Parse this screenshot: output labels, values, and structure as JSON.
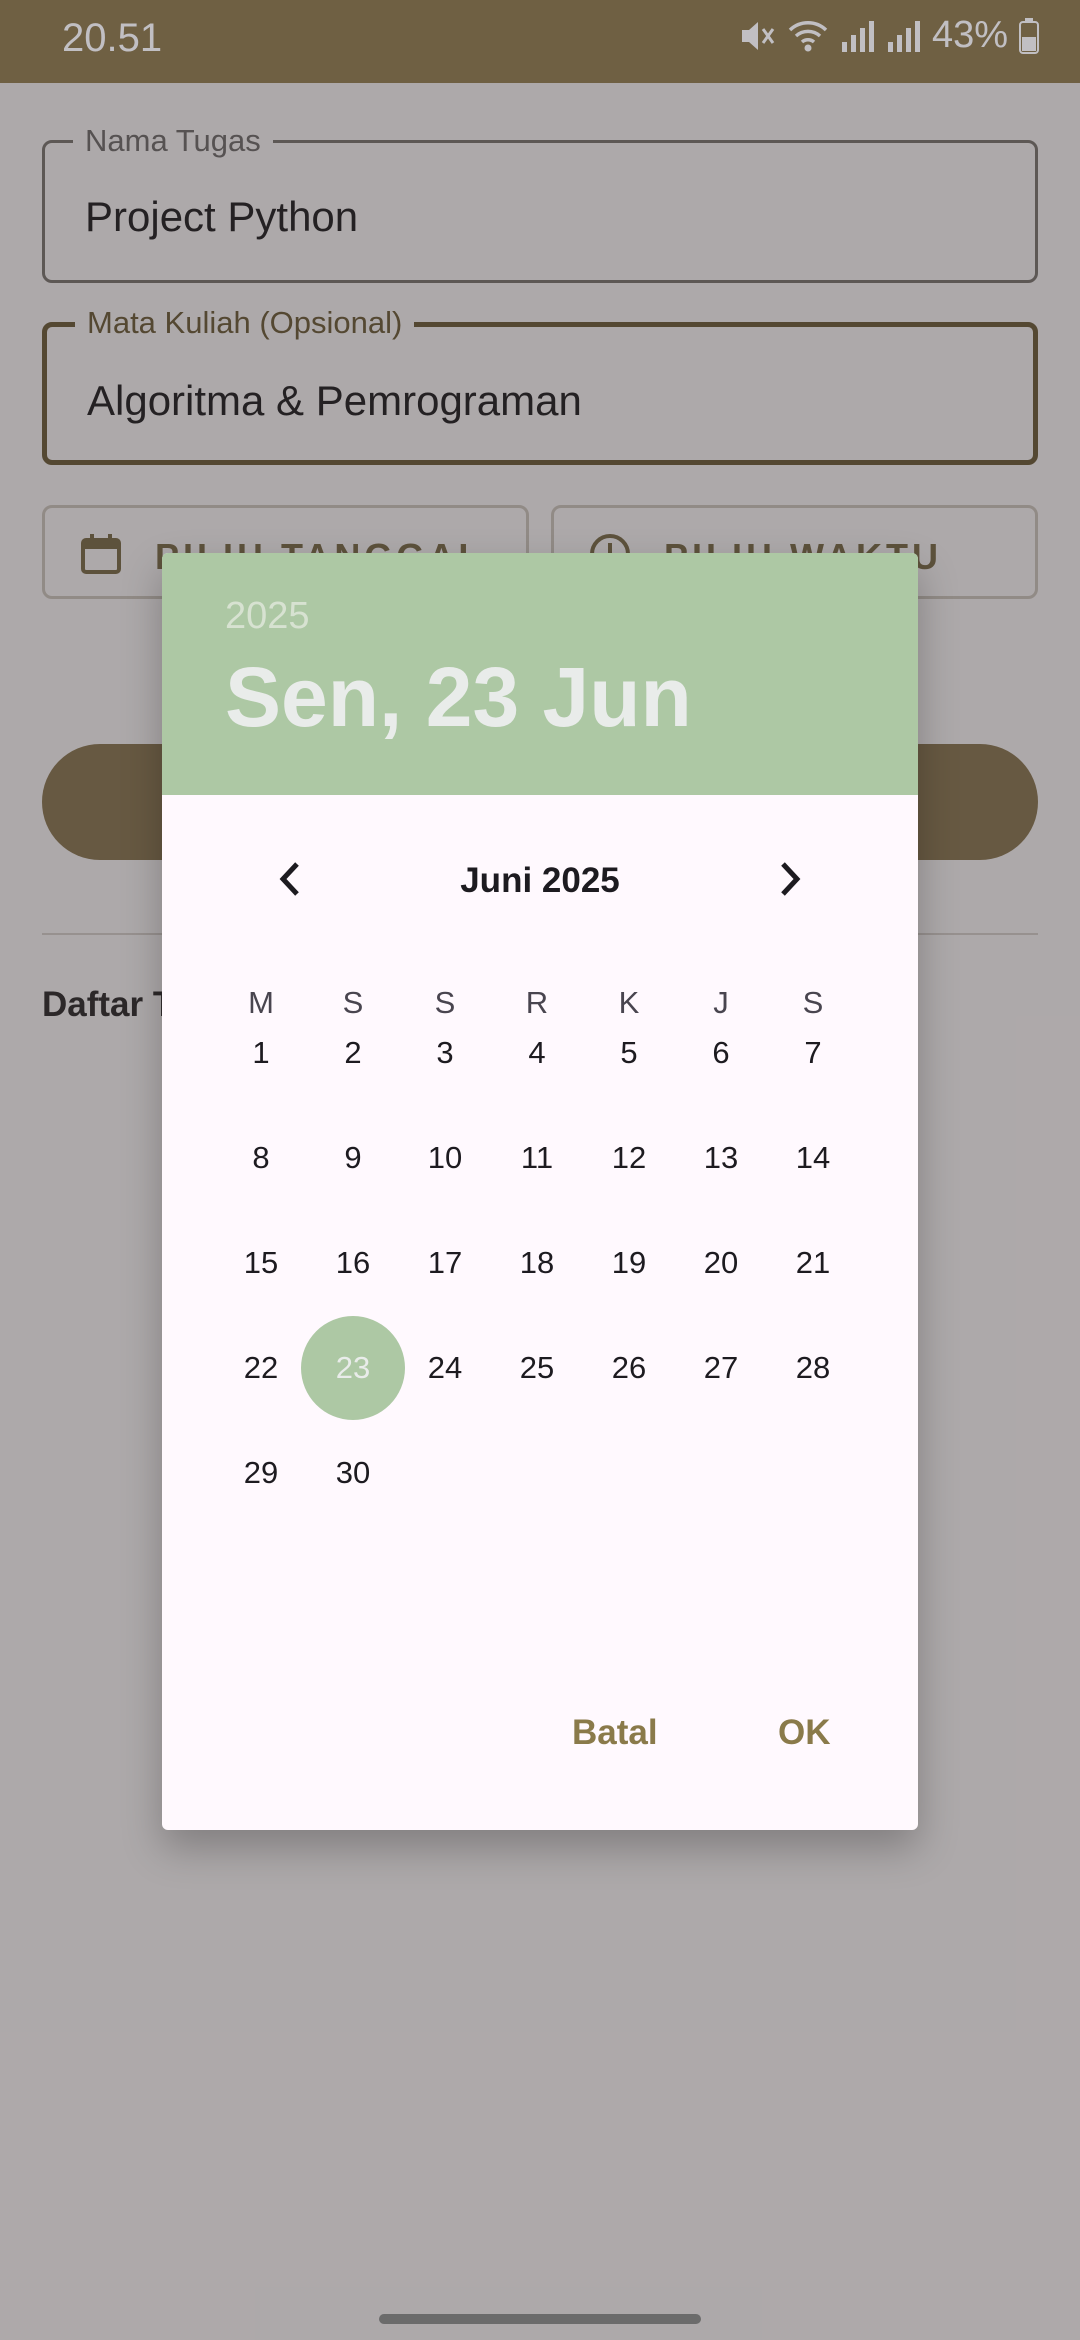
{
  "status_bar": {
    "time": "20.51",
    "battery": "43%"
  },
  "form": {
    "task_label": "Nama Tugas",
    "task_value": "Project Python",
    "course_label": "Mata Kuliah (Opsional)",
    "course_value": "Algoritma & Pemrograman",
    "pick_date": "PILIH TANGGAL",
    "pick_time": "PILIH WAKTU",
    "list_title": "Daftar T"
  },
  "dialog": {
    "year": "2025",
    "selected_date": "Sen, 23 Jun",
    "month_title": "Juni 2025",
    "weekdays": [
      "M",
      "S",
      "S",
      "R",
      "K",
      "J",
      "S"
    ],
    "days": [
      "1",
      "2",
      "3",
      "4",
      "5",
      "6",
      "7",
      "8",
      "9",
      "10",
      "11",
      "12",
      "13",
      "14",
      "15",
      "16",
      "17",
      "18",
      "19",
      "20",
      "21",
      "22",
      "23",
      "24",
      "25",
      "26",
      "27",
      "28",
      "29",
      "30"
    ],
    "selected_day": "23",
    "cancel": "Batal",
    "ok": "OK"
  },
  "colors": {
    "brand": "#8a7748",
    "header_green": "#adc8a4",
    "dialog_bg": "#fff9fe",
    "action_text": "#8a7a4a"
  },
  "icons": {
    "prev": "chevron-left-icon",
    "next": "chevron-right-icon",
    "calendar": "calendar-icon",
    "clock": "clock-icon",
    "mute": "vibrate-mute-icon",
    "wifi": "wifi-icon",
    "signal": "signal-icon",
    "battery": "battery-icon"
  }
}
